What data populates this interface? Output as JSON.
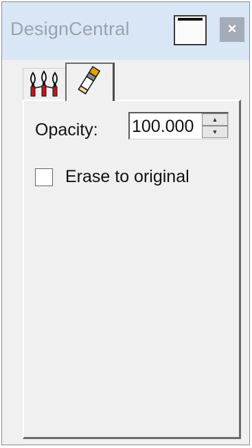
{
  "window": {
    "title": "DesignCentral",
    "close_glyph": "×",
    "restore_icon": "restore-window-icon"
  },
  "tabs": [
    {
      "icon": "multi-brush-icon",
      "active": false
    },
    {
      "icon": "eraser-icon",
      "active": true
    }
  ],
  "panel": {
    "opacity_label": "Opacity:",
    "opacity_value": "100.000",
    "spin_up_glyph": "▲",
    "spin_down_glyph": "▼",
    "erase_label": "Erase to original",
    "erase_checked": false
  },
  "colors": {
    "titlebar_bg": "#d9e6f5",
    "title_text": "#9aa3ad",
    "close_button_bg": "#a3acb7",
    "brush_red": "#c0171e",
    "eraser_yellow": "#e0a400"
  }
}
